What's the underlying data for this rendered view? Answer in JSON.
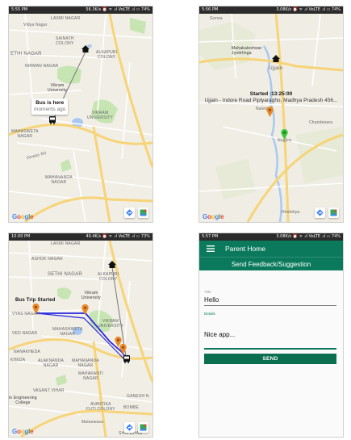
{
  "screen1": {
    "status": {
      "time": "5:55 PM",
      "right": "56.3K/s  ⏰ ᯤ .ıl VoLTE .ıl ▭ 74%"
    },
    "labels": {
      "laxmi_nagar": "LAXMI NAGAR",
      "vidya_nagar": "Vidya Nagar",
      "sainath_colony": "SAINATH\nCOLONY",
      "sethi_nagar": "ETHI NAGAR",
      "alkapuri_colony": "ALKAPURI\nCOLONY",
      "nirman_nagar": "NIRMAN NAGAR",
      "vikram_university": "Vikram\nUniversity",
      "vikram_university_caps": "VIKRAM\nUNIVERSITY",
      "mahasweta_nagar": "MAHASWETA\nNAGAR",
      "mahananda_nagar": "MAHANANDA\nNAGAR",
      "devas_road": "Dewas Rd"
    },
    "callout": {
      "title": "Bus is here",
      "subtitle": "moments ago"
    },
    "google": "Google"
  },
  "screen2": {
    "status": {
      "time": "5:56 PM",
      "right": "3.08K/s ⏰ ᯤ .ıl VoLTE .ıl ▭ 74%"
    },
    "labels": {
      "gonsa": "Gonsa",
      "mahakaleshwar": "Mahakaleshwar\nJyotirlinga",
      "ujjain": "Ujjain",
      "chandesara": "Chandesara",
      "hindoliya": "Hindoliya",
      "naleta": "Naleta",
      "nagjira": "Nagjira"
    },
    "started": {
      "title": "Started :13:25:00",
      "address": "Ujjain - Indore Road Piplyaragho, Madhya Pradesh 456..."
    },
    "google": "Google"
  },
  "screen3": {
    "status": {
      "time": "10:00 PM",
      "right": "40.4K/s ⏰ ᯤ .ıl VoLTE .ıl ▭ 73%"
    },
    "labels": {
      "laxmi_nagar": "LAXMI NAGAR",
      "ashok_nagar": "ASHOK NAGAR",
      "sethi_nagar": "SETHI NAGAR",
      "alkapuri_colony": "ALKAPURI\nCOLONY",
      "vikram_university": "Vikram\nUniversity",
      "vikram_university_caps": "VIKRAM\nUNIVERSITY",
      "vyas_nagar": "VYAS NAGAR",
      "ved_nagar": "VED NAGAR",
      "mahasweta_nagar": "MAHASHWETA\nNAGAR",
      "nanakheda": "NANAKHEDA",
      "kheda": "KHEDA",
      "alaknanda_nagar": "ALAKNANDA\nNAGAR",
      "mahananda_nagar": "MAHANANDA\nNAGAR",
      "mahakanti_nagar": "MAHAKANTI\nNAGAR",
      "vasant_vihar": "VASANT VIHAR",
      "engineering_college": "in Engineering\nCollege",
      "avantika_colony": "AVANTIKA\nFUTI COLONY",
      "ganesh_nagar": "GANESH N",
      "bombe": "BOMBE",
      "malanwasa": "Malanwasa",
      "shiv_dham": "SHIV DHAM"
    },
    "bus_trip_label": "Bus Trip Started",
    "google": "Google"
  },
  "screen4": {
    "status": {
      "time": "5:57 PM",
      "right": "3.08K/s ⏰ ᯤ .ıl VoLTE .ıl ▭ 74%"
    },
    "app_title": "Parent Home",
    "subtitle": "Send Feedback/Suggestion",
    "title_label": "Title",
    "title_value": "Hello",
    "details_label": "Details",
    "details_value": "Nice app...",
    "send_label": "SEND"
  },
  "colors": {
    "app_green": "#0b7a5c",
    "route_blue": "#2a2ae0",
    "marker_orange": "#e8892a",
    "marker_green": "#3cc43c",
    "road_yellow": "#f6d477",
    "water": "#a9c9f2",
    "park": "#c7e5b3"
  },
  "icons": [
    "home-icon",
    "bus-icon",
    "directions-icon",
    "maps-icon",
    "hamburger-menu-icon",
    "pin-icon"
  ]
}
